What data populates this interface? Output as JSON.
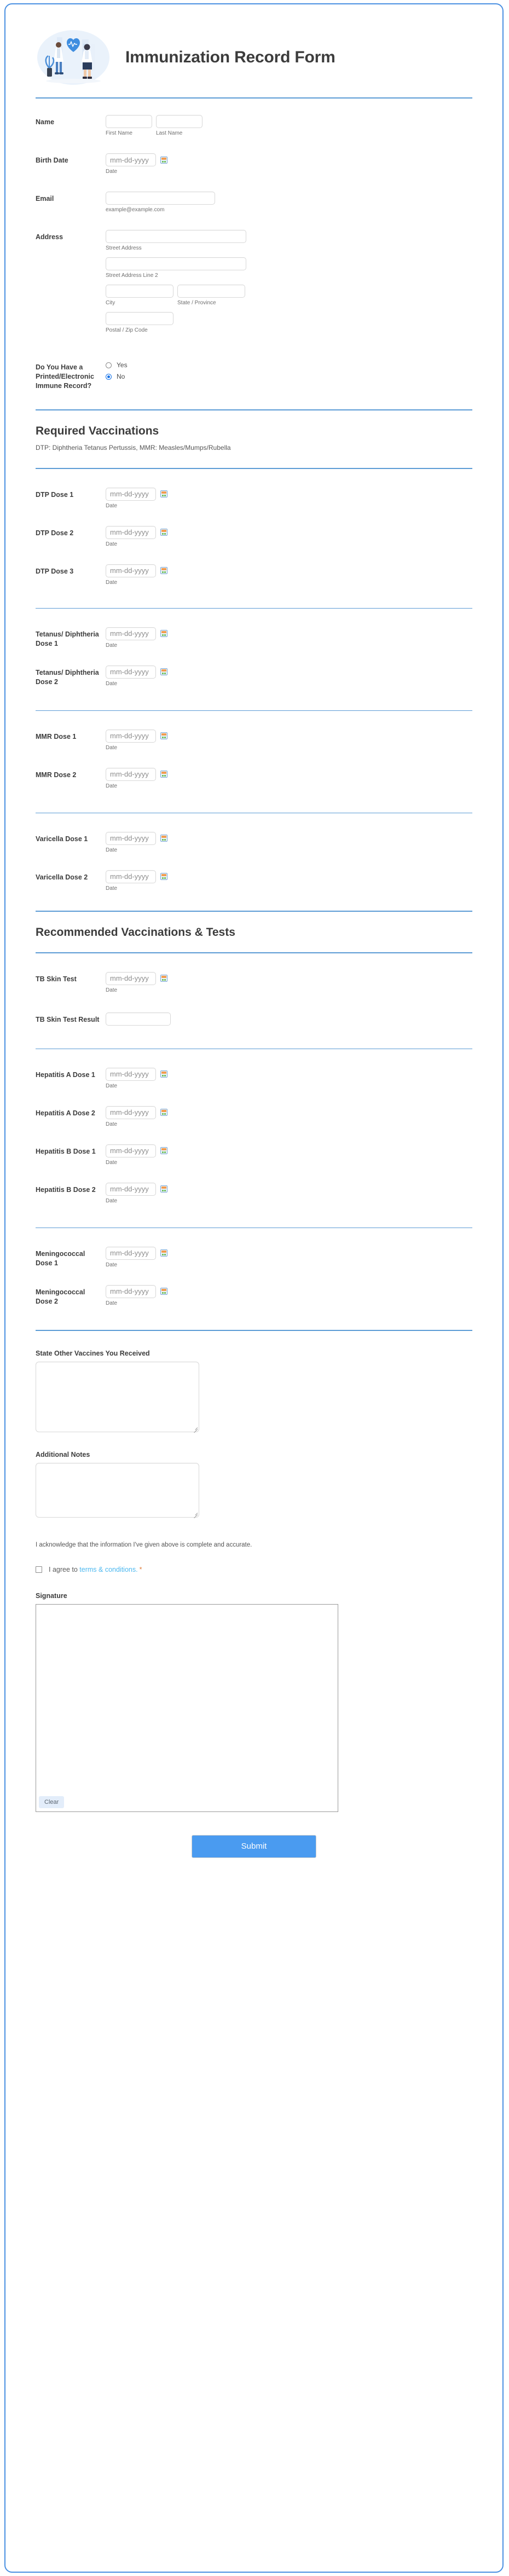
{
  "header": {
    "title": "Immunization Record Form",
    "illustration": "doctors-heart-illustration"
  },
  "personal": {
    "name": {
      "label": "Name",
      "first_sub": "First Name",
      "last_sub": "Last Name",
      "first_value": "",
      "last_value": ""
    },
    "birth_date": {
      "label": "Birth Date",
      "placeholder": "mm-dd-yyyy",
      "sub": "Date",
      "value": ""
    },
    "email": {
      "label": "Email",
      "sub": "example@example.com",
      "value": ""
    },
    "address": {
      "label": "Address",
      "street_sub": "Street Address",
      "street2_sub": "Street Address Line 2",
      "city_sub": "City",
      "state_sub": "State / Province",
      "zip_sub": "Postal / Zip Code",
      "street_value": "",
      "street2_value": "",
      "city_value": "",
      "state_value": "",
      "zip_value": ""
    },
    "printed_record": {
      "label": "Do You Have a Printed/Electronic Immune Record?",
      "options": [
        "Yes",
        "No"
      ],
      "selected": "No"
    }
  },
  "required_section": {
    "title": "Required Vaccinations",
    "subtitle": "DTP: Diphtheria Tetanus Pertussis, MMR: Measles/Mumps/Rubella",
    "date_placeholder": "mm-dd-yyyy",
    "date_sub": "Date",
    "groups": [
      {
        "fields": [
          {
            "label": "DTP Dose 1",
            "value": ""
          },
          {
            "label": "DTP Dose 2",
            "value": ""
          },
          {
            "label": "DTP Dose 3",
            "value": ""
          }
        ]
      },
      {
        "fields": [
          {
            "label": "Tetanus/ Diphtheria Dose 1",
            "value": ""
          },
          {
            "label": "Tetanus/ Diphtheria Dose 2",
            "value": ""
          }
        ]
      },
      {
        "fields": [
          {
            "label": "MMR Dose 1",
            "value": ""
          },
          {
            "label": "MMR Dose 2",
            "value": ""
          }
        ]
      },
      {
        "fields": [
          {
            "label": "Varicella Dose 1",
            "value": ""
          },
          {
            "label": "Varicella Dose 2",
            "value": ""
          }
        ]
      }
    ]
  },
  "recommended_section": {
    "title": "Recommended Vaccinations & Tests",
    "date_placeholder": "mm-dd-yyyy",
    "date_sub": "Date",
    "tb_skin_test": {
      "label": "TB Skin Test",
      "value": ""
    },
    "tb_result": {
      "label": "TB Skin Test Result",
      "value": ""
    },
    "groups": [
      {
        "fields": [
          {
            "label": "Hepatitis A Dose 1",
            "value": ""
          },
          {
            "label": "Hepatitis A Dose 2",
            "value": ""
          },
          {
            "label": "Hepatitis B Dose 1",
            "value": ""
          },
          {
            "label": "Hepatitis B Dose 2",
            "value": ""
          }
        ]
      },
      {
        "fields": [
          {
            "label": "Meningococcal Dose 1",
            "value": ""
          },
          {
            "label": "Meningococcal Dose 2",
            "value": ""
          }
        ]
      }
    ]
  },
  "notes": {
    "other_vaccines": {
      "label": "State Other Vaccines You Received",
      "value": ""
    },
    "additional_notes": {
      "label": "Additional Notes",
      "value": ""
    }
  },
  "acknowledgement": {
    "text": "I acknowledge that the information I've given above is complete and accurate.",
    "terms_prefix": "I agree to ",
    "terms_link": "terms & conditions.",
    "required_marker": "*",
    "checked": false
  },
  "signature": {
    "label": "Signature",
    "clear_label": "Clear"
  },
  "footer": {
    "submit_label": "Submit"
  },
  "colors": {
    "accent_blue": "#5b9bd5",
    "submit_blue": "#4a9bf0",
    "link_blue": "#4cb8f0",
    "radio_blue": "#1572e8",
    "required_orange": "#e07b39",
    "text_dark": "#3c3c3c",
    "text_muted": "#6f6f6f"
  },
  "icons": {
    "calendar": "calendar-icon"
  }
}
